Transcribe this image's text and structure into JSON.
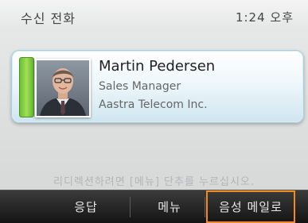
{
  "status": {
    "title": "수신 전화",
    "time": "1:24 오후"
  },
  "call": {
    "name": "Martin Pedersen",
    "title": "Sales Manager",
    "company": "Aastra Telecom Inc.",
    "presence_color": "#7ccb3f"
  },
  "hint": "리디렉션하려면 [메뉴] 단추를 누르십시오.",
  "softkeys": [
    {
      "label": "응답",
      "selected": false
    },
    {
      "label": "메뉴",
      "selected": false
    },
    {
      "label": "음성 메일로",
      "selected": true
    }
  ],
  "colors": {
    "selection": "#f28a1e",
    "softkey_bar": "#1e1e1e"
  },
  "icons": {
    "avatar": "caller-photo"
  }
}
